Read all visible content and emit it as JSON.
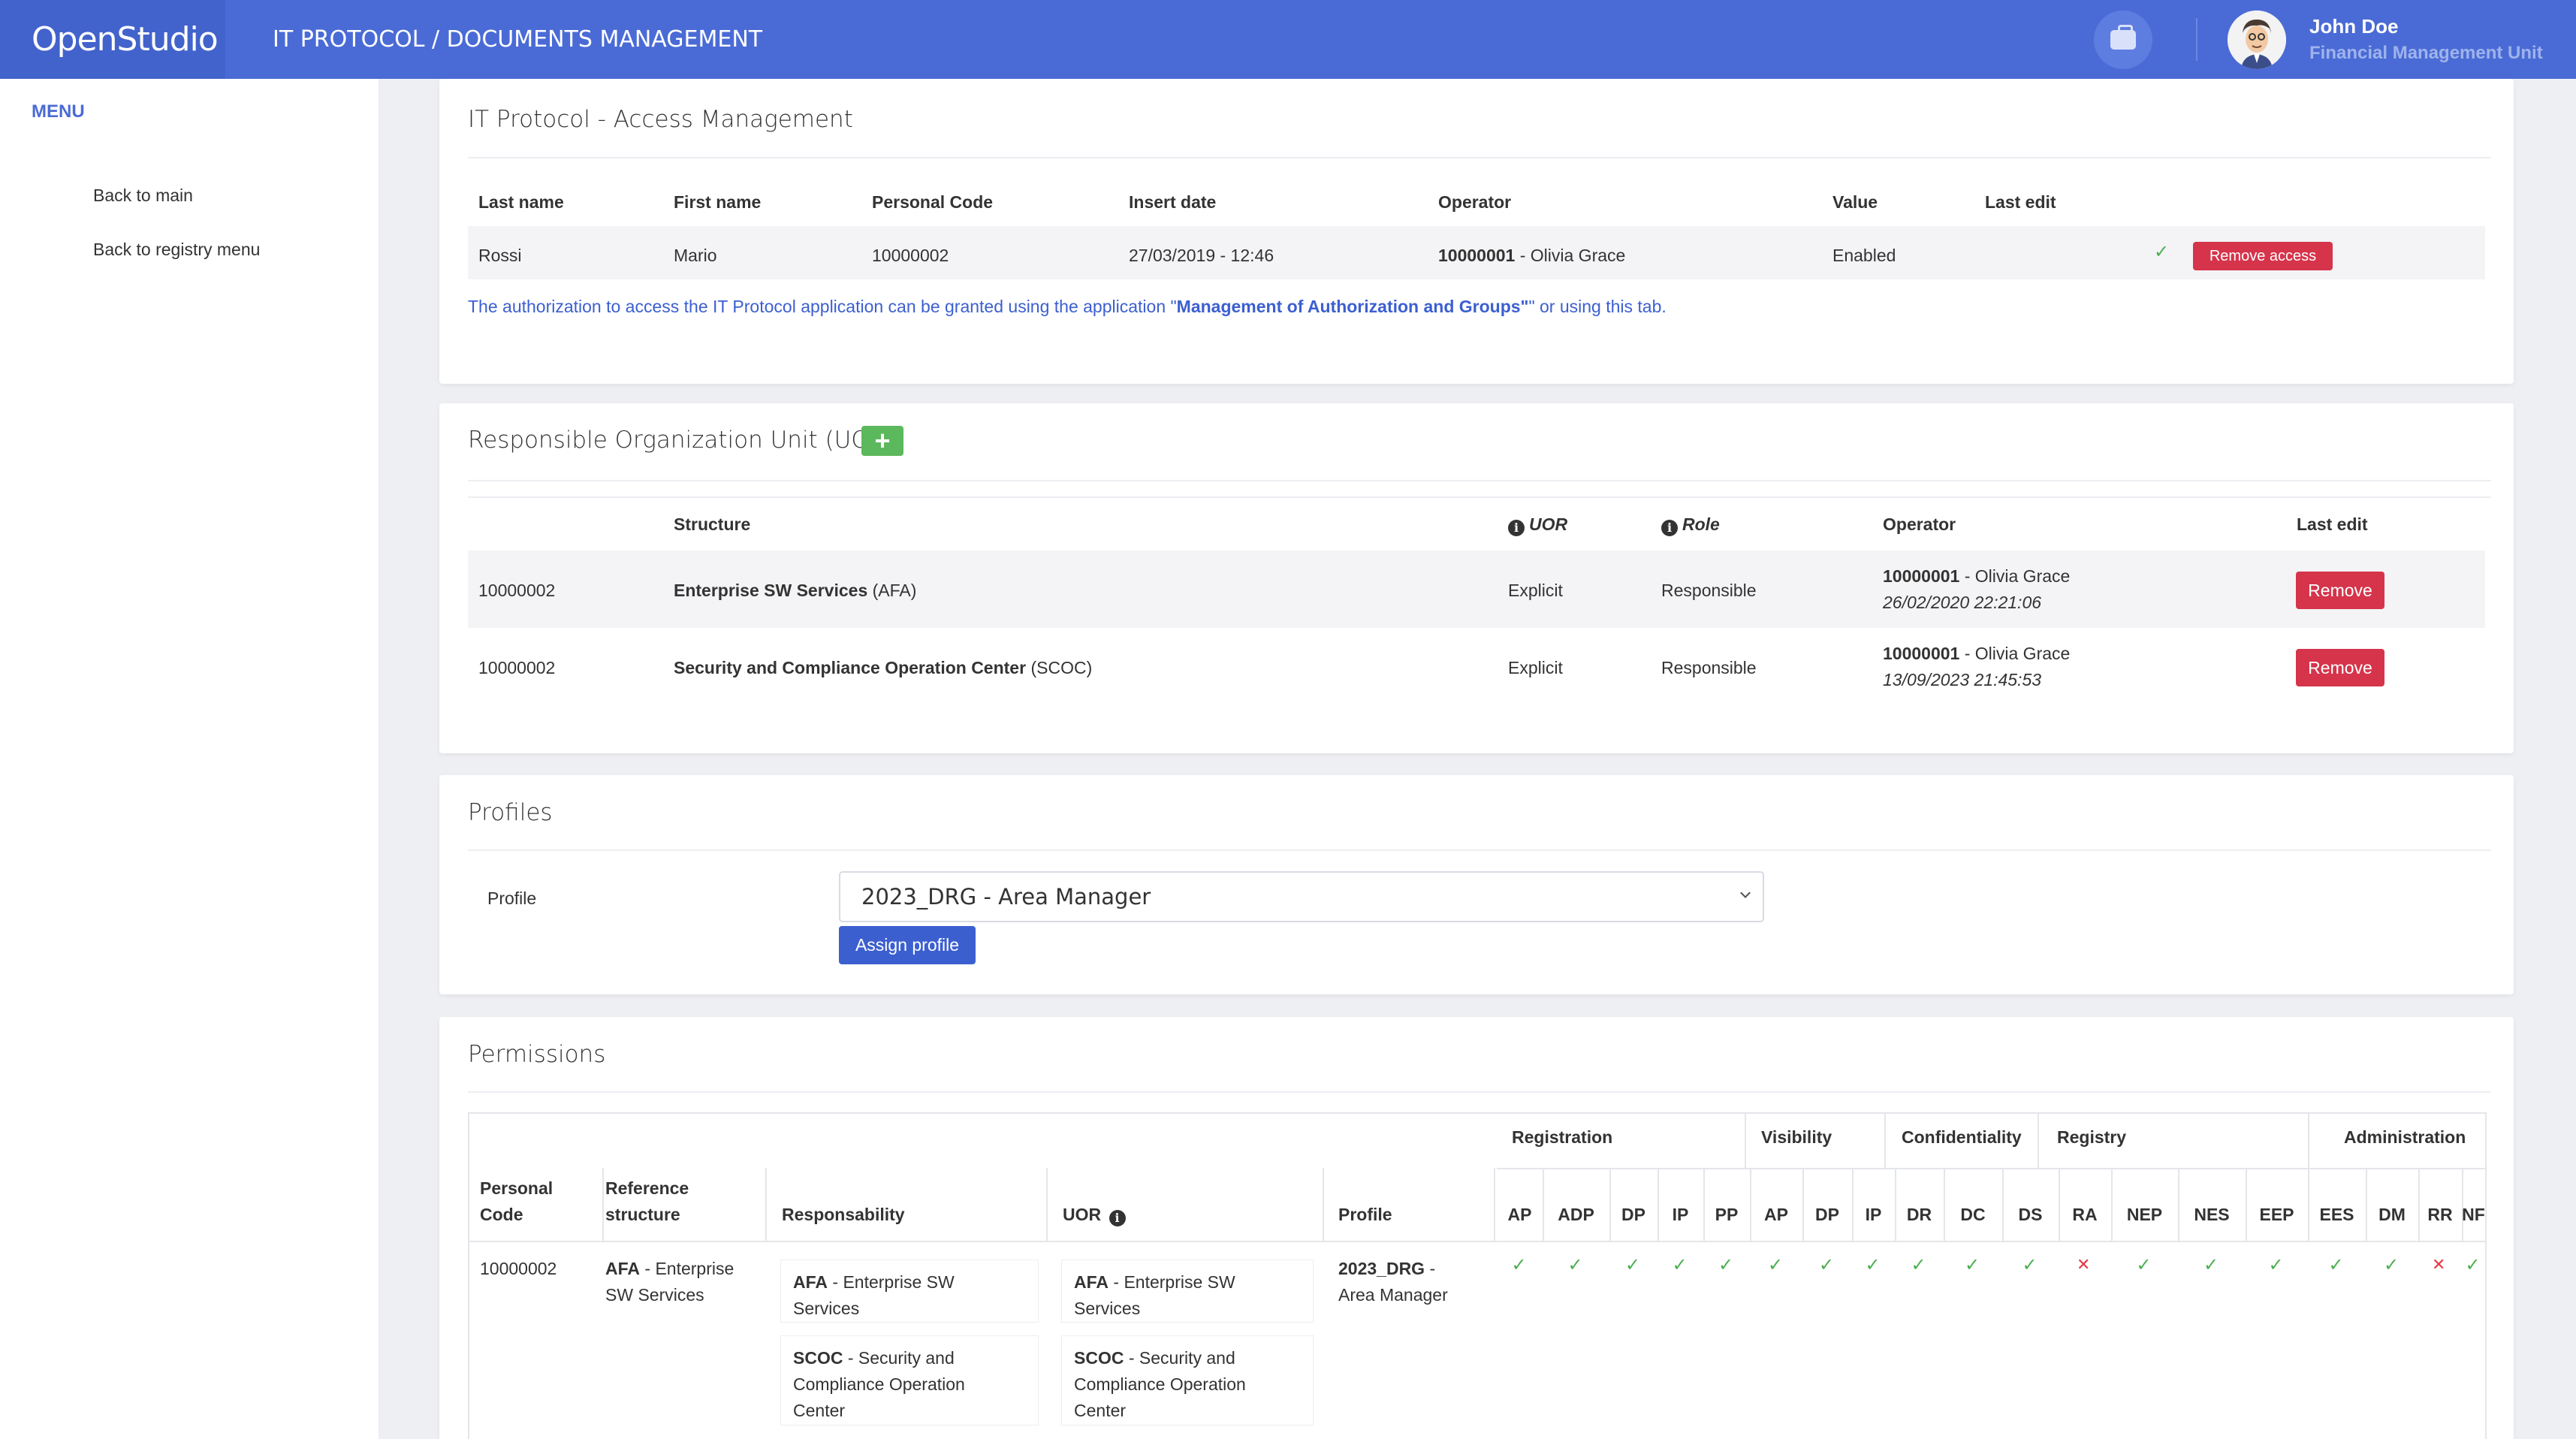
{
  "header": {
    "brand": "OpenStudio",
    "app_title": "IT PROTOCOL / DOCUMENTS MANAGEMENT",
    "user_name": "John Doe",
    "user_unit": "Financial Management Unit"
  },
  "sidebar": {
    "menu_title": "MENU",
    "items": [
      {
        "label": "Back to main"
      },
      {
        "label": "Back to registry menu"
      }
    ]
  },
  "access": {
    "title": "IT Protocol - Access Management",
    "headers": [
      "Last name",
      "First name",
      "Personal Code",
      "Insert date",
      "Operator",
      "Value",
      "Last edit"
    ],
    "row": {
      "last_name": "Rossi",
      "first_name": "Mario",
      "code": "10000002",
      "insert_date": "27/03/2019 - 12:46",
      "operator_code": "10000001",
      "operator_name": " - Olivia Grace",
      "value": "Enabled",
      "remove_label": "Remove access"
    },
    "note_pre": "The authorization to access the IT Protocol application can be granted using the application \"",
    "note_link": "Management of Authorization and Groups\"",
    "note_post": "\" or using this tab."
  },
  "uor": {
    "title": "Responsible Organization Unit (UOR)",
    "add_label": "+",
    "headers": {
      "structure": "Structure",
      "uor": "UOR",
      "role": "Role",
      "operator": "Operator",
      "last_edit": "Last edit"
    },
    "rows": [
      {
        "code": "10000002",
        "structure": "Enterprise SW Services",
        "abbr": " (AFA)",
        "uor": "Explicit",
        "role": "Responsible",
        "op_code": "10000001",
        "op_name": " - Olivia Grace",
        "date": "26/02/2020 22:21:06",
        "remove": "Remove"
      },
      {
        "code": "10000002",
        "structure": "Security and Compliance Operation Center",
        "abbr": " (SCOC)",
        "uor": "Explicit",
        "role": "Responsible",
        "op_code": "10000001",
        "op_name": " - Olivia Grace",
        "date": "13/09/2023 21:45:53",
        "remove": "Remove"
      }
    ]
  },
  "profiles": {
    "title": "Profiles",
    "label": "Profile",
    "selected": "2023_DRG - Area Manager",
    "assign_label": "Assign profile"
  },
  "permissions": {
    "title": "Permissions",
    "groups": [
      "Registration",
      "Visibility",
      "Confidentiality",
      "Registry",
      "Administration"
    ],
    "col_personal_1": "Personal",
    "col_personal_2": "Code",
    "col_ref_1": "Reference",
    "col_ref_2": "structure",
    "col_resp": "Responsability",
    "col_uor": "UOR",
    "col_profile": "Profile",
    "codes": [
      "AP",
      "ADP",
      "DP",
      "IP",
      "PP",
      "AP",
      "DP",
      "IP",
      "DR",
      "DC",
      "DS",
      "RA",
      "NEP",
      "NES",
      "EEP",
      "EES",
      "DM",
      "RR",
      "NF"
    ],
    "flags": [
      true,
      true,
      true,
      true,
      true,
      true,
      true,
      true,
      true,
      true,
      true,
      false,
      true,
      true,
      true,
      true,
      true,
      false,
      true
    ],
    "row": {
      "code": "10000002",
      "ref_bold": "AFA",
      "ref_rest_1": " - Enterprise",
      "ref_rest_2": "SW Services",
      "resp": [
        {
          "bold": "AFA",
          "l1": " - Enterprise SW",
          "l2": "Services",
          "l3": ""
        },
        {
          "bold": "SCOC",
          "l1": " - Security and",
          "l2": "Compliance Operation",
          "l3": "Center"
        }
      ],
      "uor": [
        {
          "bold": "AFA",
          "l1": " - Enterprise SW",
          "l2": "Services",
          "l3": ""
        },
        {
          "bold": "SCOC",
          "l1": " - Security and",
          "l2": "Compliance Operation",
          "l3": "Center"
        }
      ],
      "profile_bold": "2023_DRG",
      "profile_rest_1": " -",
      "profile_rest_2": "Area Manager"
    }
  }
}
